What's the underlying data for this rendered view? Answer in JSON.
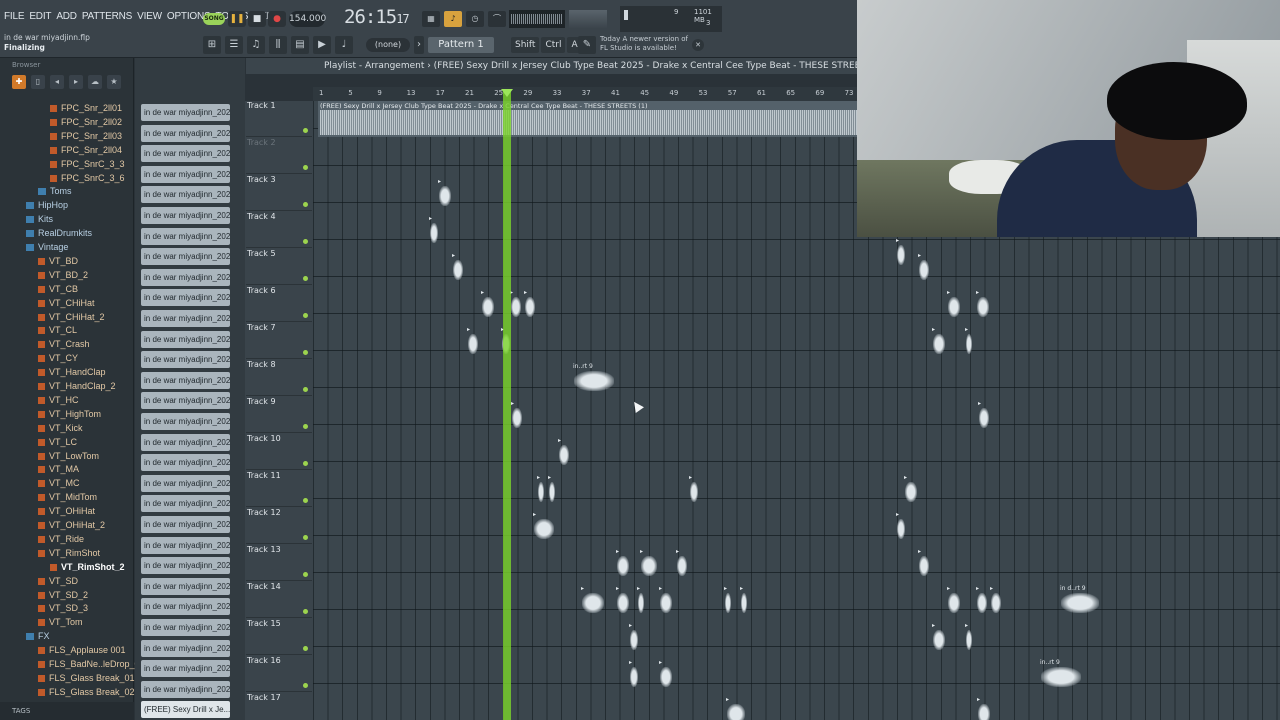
{
  "menu": [
    "FILE",
    "EDIT",
    "ADD",
    "PATTERNS",
    "VIEW",
    "OPTIONS",
    "TOOLS",
    "HELP"
  ],
  "transport": {
    "mode": "SONG",
    "tempo": "154.000",
    "time_main": "26:15",
    "time_sub": "17"
  },
  "cpu": {
    "cpu_value": "9",
    "ram": "1101 MB",
    "poly": "3"
  },
  "hint": {
    "file": "in de war miyadjinn.flp",
    "status": "Finalizing"
  },
  "snap": "(none)",
  "pattern": "Pattern 1",
  "keys": [
    "Shift",
    "Ctrl",
    "Alt"
  ],
  "news": {
    "line1": "Today   A newer version of",
    "line2": "FL Studio is available!"
  },
  "browser": {
    "title": "Browser",
    "items": [
      {
        "label": "FPC_Snr_2ll01",
        "type": "file",
        "indent": 3
      },
      {
        "label": "FPC_Snr_2ll02",
        "type": "file",
        "indent": 3
      },
      {
        "label": "FPC_Snr_2ll03",
        "type": "file",
        "indent": 3
      },
      {
        "label": "FPC_Snr_2ll04",
        "type": "file",
        "indent": 3
      },
      {
        "label": "FPC_SnrC_3_3",
        "type": "file",
        "indent": 3
      },
      {
        "label": "FPC_SnrC_3_6",
        "type": "file",
        "indent": 3
      },
      {
        "label": "Toms",
        "type": "folder",
        "indent": 2
      },
      {
        "label": "HipHop",
        "type": "folder",
        "indent": 1
      },
      {
        "label": "Kits",
        "type": "folder",
        "indent": 1
      },
      {
        "label": "RealDrumkits",
        "type": "folder",
        "indent": 1
      },
      {
        "label": "Vintage",
        "type": "folder",
        "indent": 1
      },
      {
        "label": "VT_BD",
        "type": "file",
        "indent": 2
      },
      {
        "label": "VT_BD_2",
        "type": "file",
        "indent": 2
      },
      {
        "label": "VT_CB",
        "type": "file",
        "indent": 2
      },
      {
        "label": "VT_CHiHat",
        "type": "file",
        "indent": 2
      },
      {
        "label": "VT_CHiHat_2",
        "type": "file",
        "indent": 2
      },
      {
        "label": "VT_CL",
        "type": "file",
        "indent": 2
      },
      {
        "label": "VT_Crash",
        "type": "file",
        "indent": 2
      },
      {
        "label": "VT_CY",
        "type": "file",
        "indent": 2
      },
      {
        "label": "VT_HandClap",
        "type": "file",
        "indent": 2
      },
      {
        "label": "VT_HandClap_2",
        "type": "file",
        "indent": 2
      },
      {
        "label": "VT_HC",
        "type": "file",
        "indent": 2
      },
      {
        "label": "VT_HighTom",
        "type": "file",
        "indent": 2
      },
      {
        "label": "VT_Kick",
        "type": "file",
        "indent": 2
      },
      {
        "label": "VT_LC",
        "type": "file",
        "indent": 2
      },
      {
        "label": "VT_LowTom",
        "type": "file",
        "indent": 2
      },
      {
        "label": "VT_MA",
        "type": "file",
        "indent": 2
      },
      {
        "label": "VT_MC",
        "type": "file",
        "indent": 2
      },
      {
        "label": "VT_MidTom",
        "type": "file",
        "indent": 2
      },
      {
        "label": "VT_OHiHat",
        "type": "file",
        "indent": 2
      },
      {
        "label": "VT_OHiHat_2",
        "type": "file",
        "indent": 2
      },
      {
        "label": "VT_Ride",
        "type": "file",
        "indent": 2
      },
      {
        "label": "VT_RimShot",
        "type": "file",
        "indent": 2
      },
      {
        "label": "VT_RimShot_2",
        "type": "selected",
        "indent": 3
      },
      {
        "label": "VT_SD",
        "type": "file",
        "indent": 2
      },
      {
        "label": "VT_SD_2",
        "type": "file",
        "indent": 2
      },
      {
        "label": "VT_SD_3",
        "type": "file",
        "indent": 2
      },
      {
        "label": "VT_Tom",
        "type": "file",
        "indent": 2
      },
      {
        "label": "FX",
        "type": "folder",
        "indent": 1
      },
      {
        "label": "FLS_Applause 001",
        "type": "file",
        "indent": 2
      },
      {
        "label": "FLS_BadNe..leDrop_02",
        "type": "file",
        "indent": 2
      },
      {
        "label": "FLS_Glass Break_01",
        "type": "file",
        "indent": 2
      },
      {
        "label": "FLS_Glass Break_02",
        "type": "file",
        "indent": 2
      }
    ],
    "tags_label": "TAGS"
  },
  "channels": {
    "label": "in de war miyadjinn_202...",
    "count": 29,
    "last_label": "(FREE) Sexy Drill x Je..."
  },
  "playlist": {
    "title": "Playlist - Arrangement › (FREE) Sexy Drill x Jersey Club Type Beat 2025 - Drake x Central Cee Type Beat - THESE STREETS (1) ›",
    "ruler": [
      "1",
      "5",
      "9",
      "13",
      "17",
      "21",
      "25",
      "29",
      "33",
      "37",
      "41",
      "45",
      "49",
      "53",
      "57",
      "61",
      "65",
      "69",
      "73"
    ],
    "audio_clip_label": "(FREE) Sexy Drill x Jersey Club Type Beat 2025 - Drake x Central Cee Type Beat - THESE STREETS (1)",
    "tracks": [
      "Track 1",
      "Track 2",
      "Track 3",
      "Track 4",
      "Track 5",
      "Track 6",
      "Track 7",
      "Track 8",
      "Track 9",
      "Track 10",
      "Track 11",
      "Track 12",
      "Track 13",
      "Track 14",
      "Track 15",
      "Track 16",
      "Track 17"
    ],
    "clip_label_a": "in..rt 9",
    "clip_label_b": "in d..rt 9"
  },
  "colors": {
    "playhead": "#7cd62a",
    "song_button": "#9ad35a",
    "record": "#e04747"
  }
}
